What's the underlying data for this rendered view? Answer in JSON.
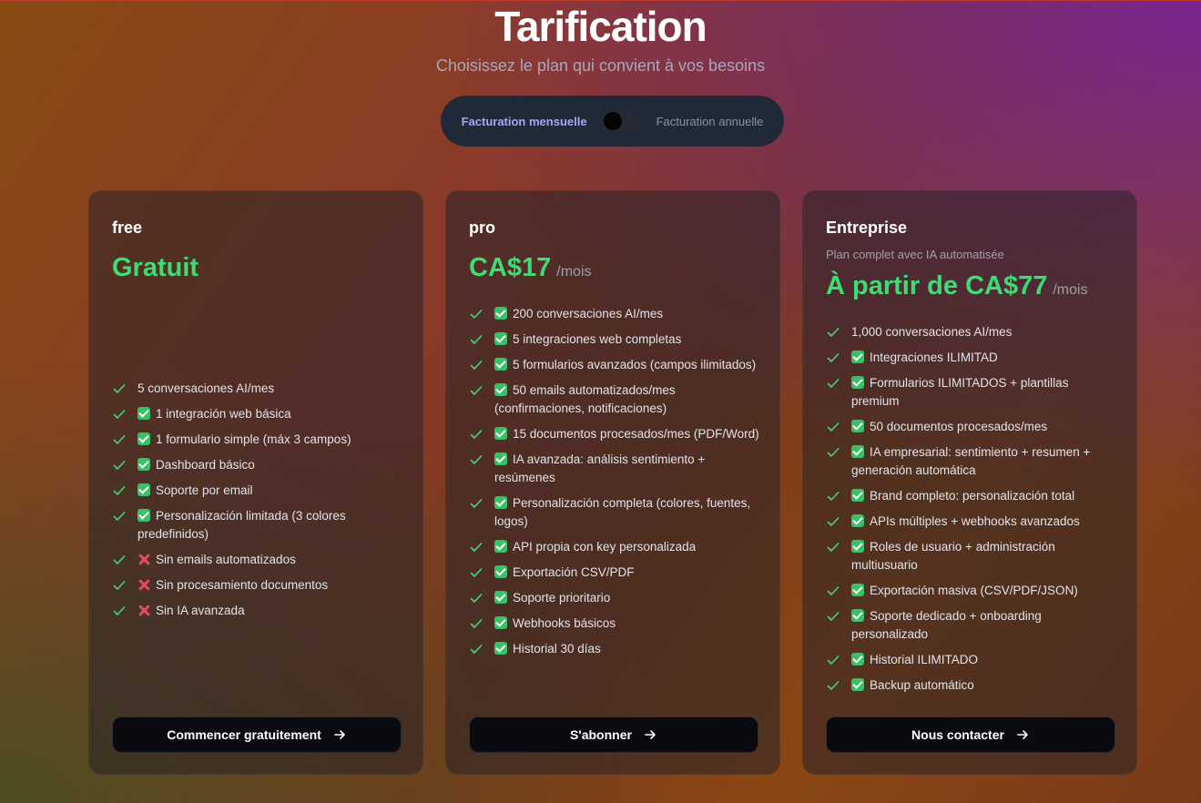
{
  "header": {
    "title": "Tarification",
    "subtitle": "Choisissez le plan qui convient à vos besoins"
  },
  "billing": {
    "monthly_label": "Facturation mensuelle",
    "annual_label": "Facturation annuelle",
    "annual_enabled": false
  },
  "colors": {
    "accent_green": "#3ddc74",
    "check_green": "#38c268",
    "cross_red": "#e8495f"
  },
  "plans": [
    {
      "name": "free",
      "price": "Gratuit",
      "period": "",
      "description": "",
      "cta_label": "Commencer gratuitement",
      "features": [
        {
          "mark": "",
          "text": "5 conversaciones AI/mes"
        },
        {
          "mark": "check",
          "text": "1 integración web básica"
        },
        {
          "mark": "check",
          "text": "1 formulario simple (máx 3 campos)"
        },
        {
          "mark": "check",
          "text": "Dashboard básico"
        },
        {
          "mark": "check",
          "text": "Soporte por email"
        },
        {
          "mark": "check",
          "text": "Personalización limitada (3 colores predefinidos)"
        },
        {
          "mark": "cross",
          "text": "Sin emails automatizados"
        },
        {
          "mark": "cross",
          "text": "Sin procesamiento documentos"
        },
        {
          "mark": "cross",
          "text": "Sin IA avanzada"
        }
      ]
    },
    {
      "name": "pro",
      "price": "CA$17",
      "period": "/mois",
      "description": "",
      "cta_label": "S'abonner",
      "features": [
        {
          "mark": "check",
          "text": "200 conversaciones AI/mes"
        },
        {
          "mark": "check",
          "text": "5 integraciones web completas"
        },
        {
          "mark": "check",
          "text": "5 formularios avanzados (campos ilimitados)"
        },
        {
          "mark": "check",
          "text": "50 emails automatizados/mes (confirmaciones, notificaciones)"
        },
        {
          "mark": "check",
          "text": "15 documentos procesados/mes (PDF/Word)"
        },
        {
          "mark": "check",
          "text": "IA avanzada: análisis sentimiento + resúmenes"
        },
        {
          "mark": "check",
          "text": "Personalización completa (colores, fuentes, logos)"
        },
        {
          "mark": "check",
          "text": "API propia con key personalizada"
        },
        {
          "mark": "check",
          "text": "Exportación CSV/PDF"
        },
        {
          "mark": "check",
          "text": "Soporte prioritario"
        },
        {
          "mark": "check",
          "text": "Webhooks básicos"
        },
        {
          "mark": "check",
          "text": "Historial 30 días"
        }
      ]
    },
    {
      "name": "Entreprise",
      "price": "À partir de CA$77",
      "period": "/mois",
      "description": "Plan complet avec IA automatisée",
      "cta_label": "Nous contacter",
      "features": [
        {
          "mark": "",
          "text": "1,000 conversaciones AI/mes"
        },
        {
          "mark": "check",
          "text": "Integraciones ILIMITAD"
        },
        {
          "mark": "check",
          "text": "Formularios ILIMITADOS + plantillas premium"
        },
        {
          "mark": "check",
          "text": "50 documentos procesados/mes"
        },
        {
          "mark": "check",
          "text": "IA empresarial: sentimiento + resumen + generación automática"
        },
        {
          "mark": "check",
          "text": "Brand completo: personalización total"
        },
        {
          "mark": "check",
          "text": "APIs múltiples + webhooks avanzados"
        },
        {
          "mark": "check",
          "text": "Roles de usuario + administración multiusuario"
        },
        {
          "mark": "check",
          "text": "Exportación masiva (CSV/PDF/JSON)"
        },
        {
          "mark": "check",
          "text": "Soporte dedicado + onboarding personalizado"
        },
        {
          "mark": "check",
          "text": "Historial ILIMITADO"
        },
        {
          "mark": "check",
          "text": "Backup automático"
        }
      ]
    }
  ]
}
